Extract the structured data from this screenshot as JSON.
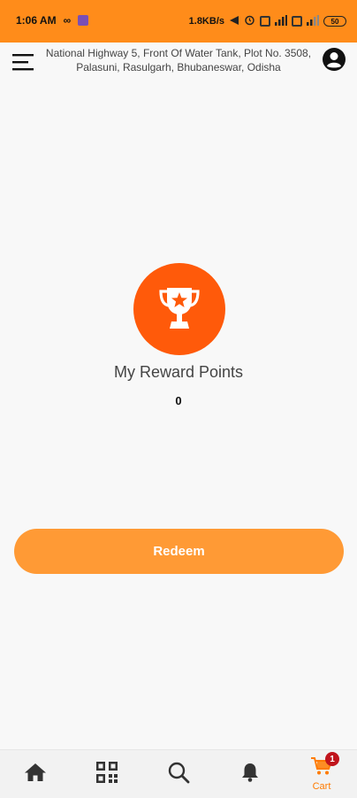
{
  "status_bar": {
    "time": "1:06 AM",
    "network_speed": "1.8KB/s",
    "battery": "50"
  },
  "header": {
    "address": "National Highway 5, Front Of Water Tank, Plot No. 3508, Palasuni, Rasulgarh, Bhubaneswar, Odisha",
    "menu_icon": "hamburger-menu-icon",
    "profile_icon": "account-circle-icon"
  },
  "rewards": {
    "title": "My Reward Points",
    "points": "0",
    "icon": "trophy-icon"
  },
  "redeem": {
    "label": "Redeem"
  },
  "bottom_nav": {
    "items": [
      {
        "icon": "home-icon"
      },
      {
        "icon": "qr-scan-icon"
      },
      {
        "icon": "search-icon"
      },
      {
        "icon": "bell-icon"
      },
      {
        "icon": "cart-icon",
        "label": "Cart",
        "badge": "1"
      }
    ]
  },
  "colors": {
    "status_bar": "#ff8c1a",
    "trophy_circle": "#ff5a0a",
    "redeem_button": "#ff9a35",
    "cart_accent": "#ff7b00",
    "badge": "#c0141c"
  }
}
